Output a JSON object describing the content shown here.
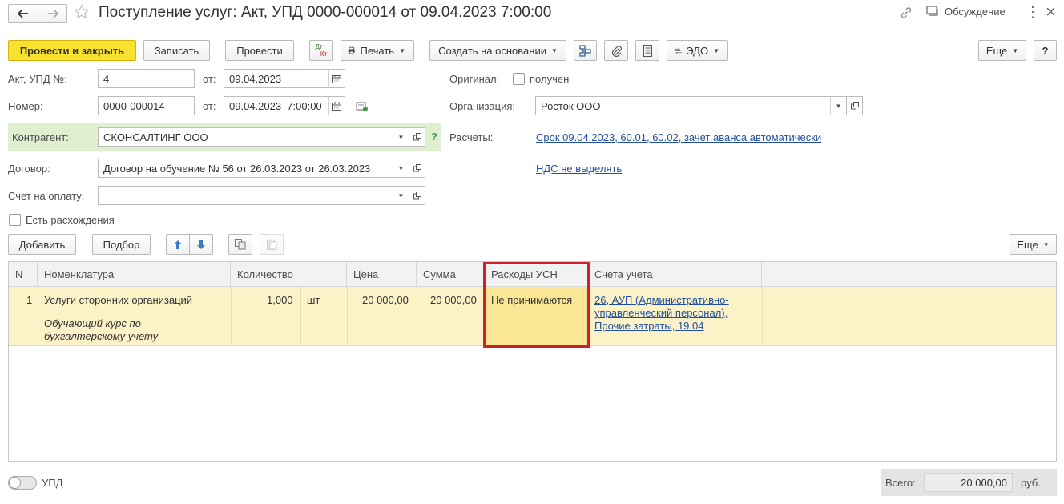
{
  "window": {
    "title": "Поступление услуг: Акт, УПД 0000-000014 от 09.04.2023 7:00:00",
    "discussion_label": "Обсуждение",
    "close_symbol": "×",
    "more_symbol": "⋮"
  },
  "toolbar": {
    "post_close": "Провести и закрыть",
    "save": "Записать",
    "post": "Провести",
    "dt_top": "Дт",
    "dt_bottom": "Кт",
    "print": "Печать",
    "create_based": "Создать на основании",
    "edo": "ЭДО",
    "more": "Еще",
    "help": "?"
  },
  "form": {
    "act_label": "Акт, УПД №:",
    "act_value": "4",
    "from_label": "от:",
    "act_date": "09.04.2023",
    "number_label": "Номер:",
    "number_value": "0000-000014",
    "from_label2": "от:",
    "number_datetime": "09.04.2023  7:00:00",
    "contractor_label": "Контрагент:",
    "contractor_value": "СКОНСАЛТИНГ ООО",
    "contractor_help": "?",
    "contract_label": "Договор:",
    "contract_value": "Договор на обучение № 56 от 26.03.2023 от 26.03.2023",
    "invoice_label": "Счет на оплату:",
    "invoice_value": "",
    "discrepancy_label": "Есть расхождения",
    "original_label": "Оригинал:",
    "original_received": "получен",
    "org_label": "Организация:",
    "org_value": "Росток ООО",
    "settlements_label": "Расчеты:",
    "settlements_link": "Срок 09.04.2023, 60.01, 60.02, зачет аванса автоматически",
    "vat_link": "НДС не выделять"
  },
  "table_toolbar": {
    "add": "Добавить",
    "select": "Подбор",
    "more": "Еще"
  },
  "table": {
    "headers": [
      "N",
      "Номенклатура",
      "Количество",
      "Цена",
      "Сумма",
      "Расходы УСН",
      "Счета учета"
    ],
    "rows": [
      {
        "n": "1",
        "item": "Услуги сторонних организаций",
        "item_note_1": "Обучающий курс по",
        "item_note_2": "бухгалтерскому учету",
        "qty": "1,000",
        "unit": "шт",
        "price": "20 000,00",
        "sum": "20 000,00",
        "usn": "Не принимаются",
        "accounts_1": "26, АУП (Административно-",
        "accounts_2": "управленческий персонал),",
        "accounts_3": "Прочие затраты, 19.04"
      }
    ]
  },
  "footer": {
    "upd_label": "УПД",
    "total_label": "Всего:",
    "total_value": "20 000,00",
    "currency": "руб."
  },
  "colors": {
    "primary": "#fbe12f",
    "link": "#2150a3",
    "highlight_border": "#d0202a",
    "selected_row": "#fcf2c8",
    "selected_cell": "#fbe696",
    "contractor_bg": "#dff0d0"
  }
}
